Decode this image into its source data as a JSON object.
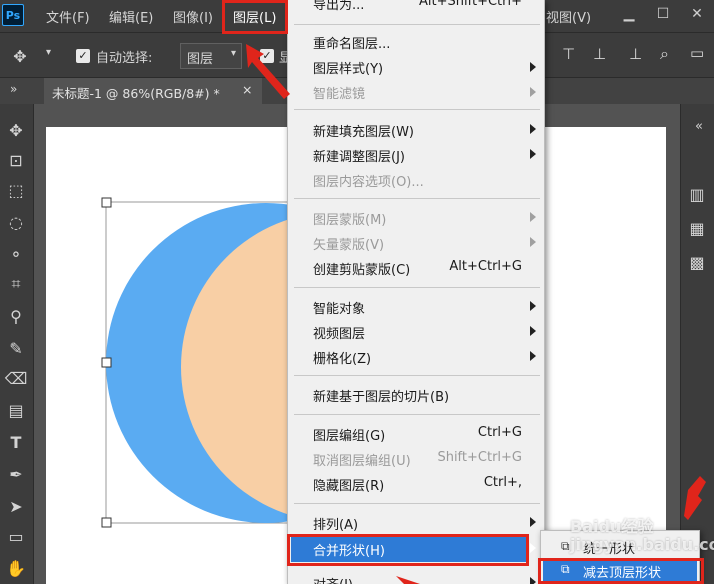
{
  "menubar": {
    "logo": "Ps",
    "items": [
      "文件(F)",
      "编辑(E)",
      "图像(I)",
      "图层(L)"
    ],
    "right_item": "视图(V)",
    "window_controls": [
      "minimize-icon",
      "maximize-icon",
      "close-icon"
    ]
  },
  "options_bar": {
    "auto_select_label": "自动选择:",
    "auto_select_value": "图层",
    "show_label": "显"
  },
  "document_tab": {
    "title": "未标题-1 @ 86%(RGB/8#) *",
    "close": "×"
  },
  "layer_menu": {
    "top_cut_label": "导出为...",
    "top_cut_shortcut": "Alt+Shift+Ctrl+",
    "items": [
      {
        "label": "重命名图层...",
        "shortcut": "",
        "submenu": false,
        "disabled": false
      },
      {
        "label": "图层样式(Y)",
        "shortcut": "",
        "submenu": true,
        "disabled": false
      },
      {
        "label": "智能滤镜",
        "shortcut": "",
        "submenu": true,
        "disabled": true
      },
      {
        "label": "新建填充图层(W)",
        "shortcut": "",
        "submenu": true,
        "disabled": false
      },
      {
        "label": "新建调整图层(J)",
        "shortcut": "",
        "submenu": true,
        "disabled": false
      },
      {
        "label": "图层内容选项(O)...",
        "shortcut": "",
        "submenu": false,
        "disabled": true
      },
      {
        "label": "图层蒙版(M)",
        "shortcut": "",
        "submenu": true,
        "disabled": true
      },
      {
        "label": "矢量蒙版(V)",
        "shortcut": "",
        "submenu": true,
        "disabled": true
      },
      {
        "label": "创建剪贴蒙版(C)",
        "shortcut": "Alt+Ctrl+G",
        "submenu": false,
        "disabled": false
      },
      {
        "label": "智能对象",
        "shortcut": "",
        "submenu": true,
        "disabled": false
      },
      {
        "label": "视频图层",
        "shortcut": "",
        "submenu": true,
        "disabled": false
      },
      {
        "label": "栅格化(Z)",
        "shortcut": "",
        "submenu": true,
        "disabled": false
      },
      {
        "label": "新建基于图层的切片(B)",
        "shortcut": "",
        "submenu": false,
        "disabled": false
      },
      {
        "label": "图层编组(G)",
        "shortcut": "Ctrl+G",
        "submenu": false,
        "disabled": false
      },
      {
        "label": "取消图层编组(U)",
        "shortcut": "Shift+Ctrl+G",
        "submenu": false,
        "disabled": true
      },
      {
        "label": "隐藏图层(R)",
        "shortcut": "Ctrl+,",
        "submenu": false,
        "disabled": false
      },
      {
        "label": "排列(A)",
        "shortcut": "",
        "submenu": true,
        "disabled": false
      },
      {
        "label": "合并形状(H)",
        "shortcut": "",
        "submenu": true,
        "disabled": false,
        "highlighted": true
      },
      {
        "label": "对齐(I)",
        "shortcut": "",
        "submenu": true,
        "disabled": false
      }
    ]
  },
  "merge_submenu": {
    "items": [
      {
        "label": "统一形状",
        "highlighted": false
      },
      {
        "label": "减去顶层形状",
        "highlighted": true
      }
    ]
  },
  "watermark": "Baidu经验\njingyan.baidu.com",
  "canvas": {
    "circle_blue_color": "#5aabf2",
    "circle_peach_color": "#f8cfa5"
  },
  "colors": {
    "menu_highlight": "#2e7bd6",
    "annotation_red": "#e0251b"
  }
}
